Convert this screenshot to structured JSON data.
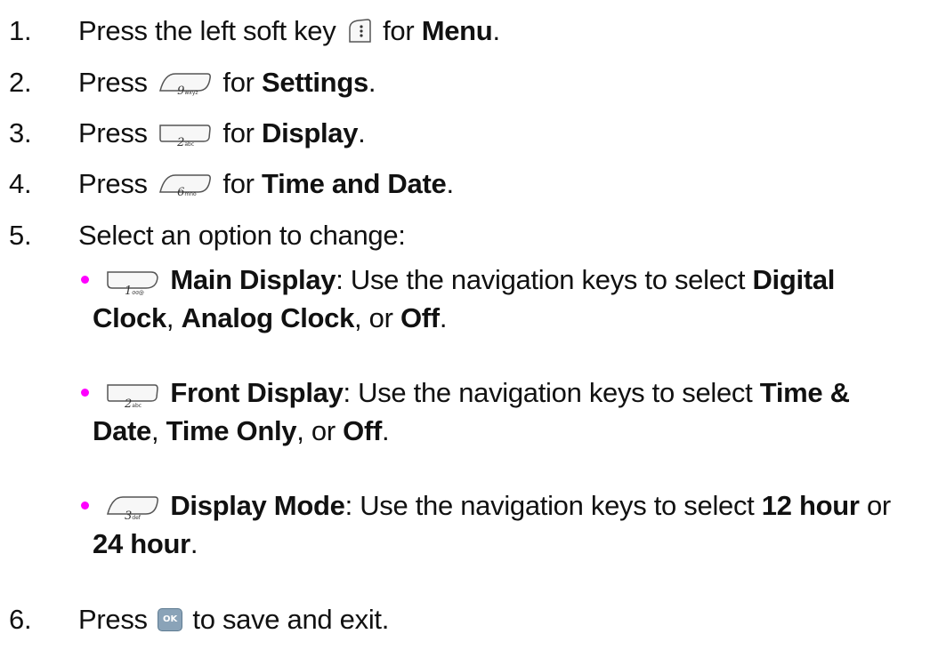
{
  "accent_color": "#ff00ff",
  "steps": [
    {
      "num": "1.",
      "pre": "Press the left soft key",
      "mid": " for ",
      "bold": "Menu",
      "post": "."
    },
    {
      "num": "2.",
      "pre": "Press",
      "mid": " for ",
      "bold": "Settings",
      "post": "."
    },
    {
      "num": "3.",
      "pre": "Press",
      "mid": " for ",
      "bold": "Display",
      "post": "."
    },
    {
      "num": "4.",
      "pre": "Press",
      "mid": " for ",
      "bold": "Time and Date",
      "post": "."
    },
    {
      "num": "5.",
      "text": "Select an option to change:"
    },
    {
      "num": "6.",
      "pre": "Press",
      "post": " to save and exit."
    }
  ],
  "keys": {
    "menu_key": "soft-key-left-icon",
    "key_9": {
      "digit": "9",
      "letters": "wxyz"
    },
    "key_2": {
      "digit": "2",
      "letters": "abc"
    },
    "key_6": {
      "digit": "6",
      "letters": "mno"
    },
    "key_1": {
      "digit": "1",
      "letters": "σσ@"
    },
    "key_3": {
      "digit": "3",
      "letters": "def"
    },
    "ok_key": "OK"
  },
  "options": [
    {
      "title": "Main Display",
      "desc": ": Use the navigation keys to select ",
      "choices": [
        "Digital Clock",
        "Analog Clock",
        "Off"
      ],
      "sep1": ", ",
      "sep2": ", or ",
      "end": "."
    },
    {
      "title": "Front Display",
      "desc": ": Use the navigation keys to select ",
      "choices": [
        "Time & Date",
        "Time Only",
        "Off"
      ],
      "sep1": ", ",
      "sep2": ", or ",
      "end": "."
    },
    {
      "title": "Display Mode",
      "desc": ": Use the navigation keys to select ",
      "choices": [
        "12 hour",
        "24 hour"
      ],
      "sep2": " or ",
      "end": "."
    }
  ]
}
